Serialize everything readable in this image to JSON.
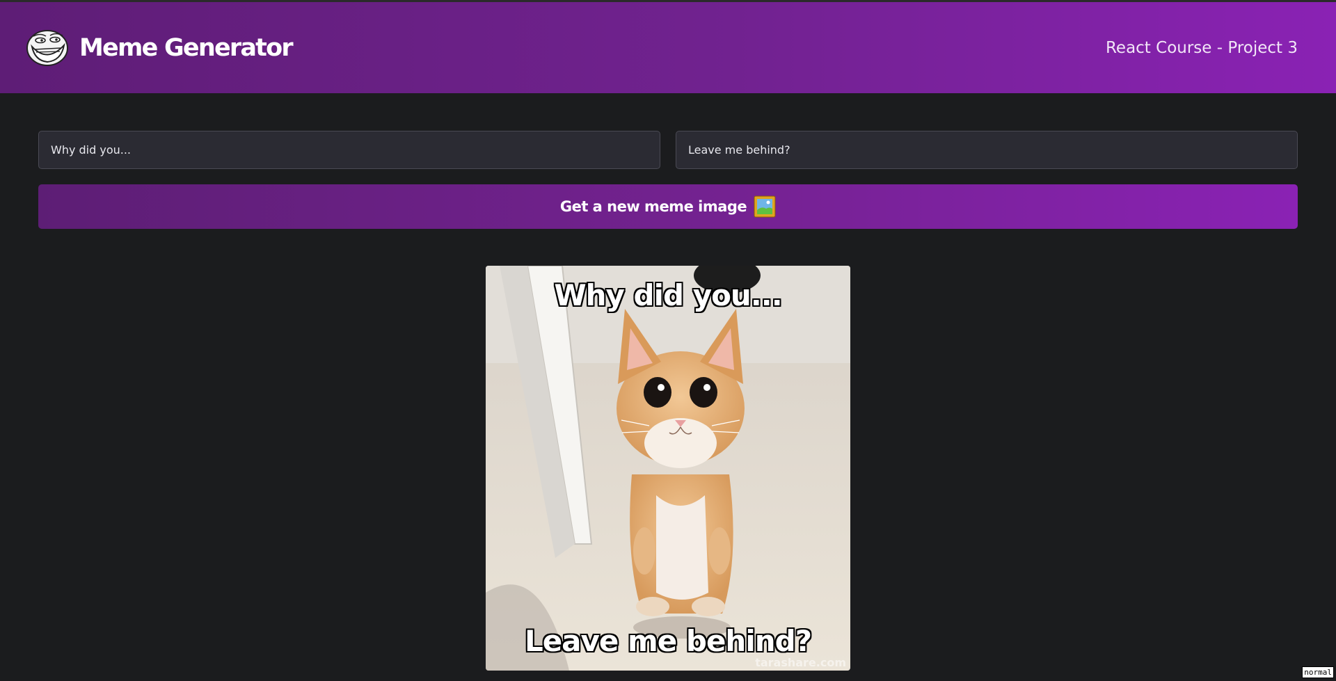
{
  "header": {
    "app_title": "Meme Generator",
    "course_label": "React Course - Project 3",
    "logo_icon": "troll-face-icon"
  },
  "form": {
    "top_text_value": "Why did you...",
    "bottom_text_value": "Leave me behind?",
    "button_label": "Get a new meme image",
    "button_icon": "framed-picture-icon"
  },
  "meme": {
    "top_text": "Why did you...",
    "bottom_text": "Leave me behind?",
    "image_subject": "kitten-standing-photo",
    "watermark": "tarashare.com"
  },
  "status": {
    "mode_badge": "normal"
  },
  "colors": {
    "header_gradient_start": "#5e1d76",
    "header_gradient_end": "#8a22b4",
    "background": "#1b1c1e",
    "input_bg": "#2b2b33"
  }
}
